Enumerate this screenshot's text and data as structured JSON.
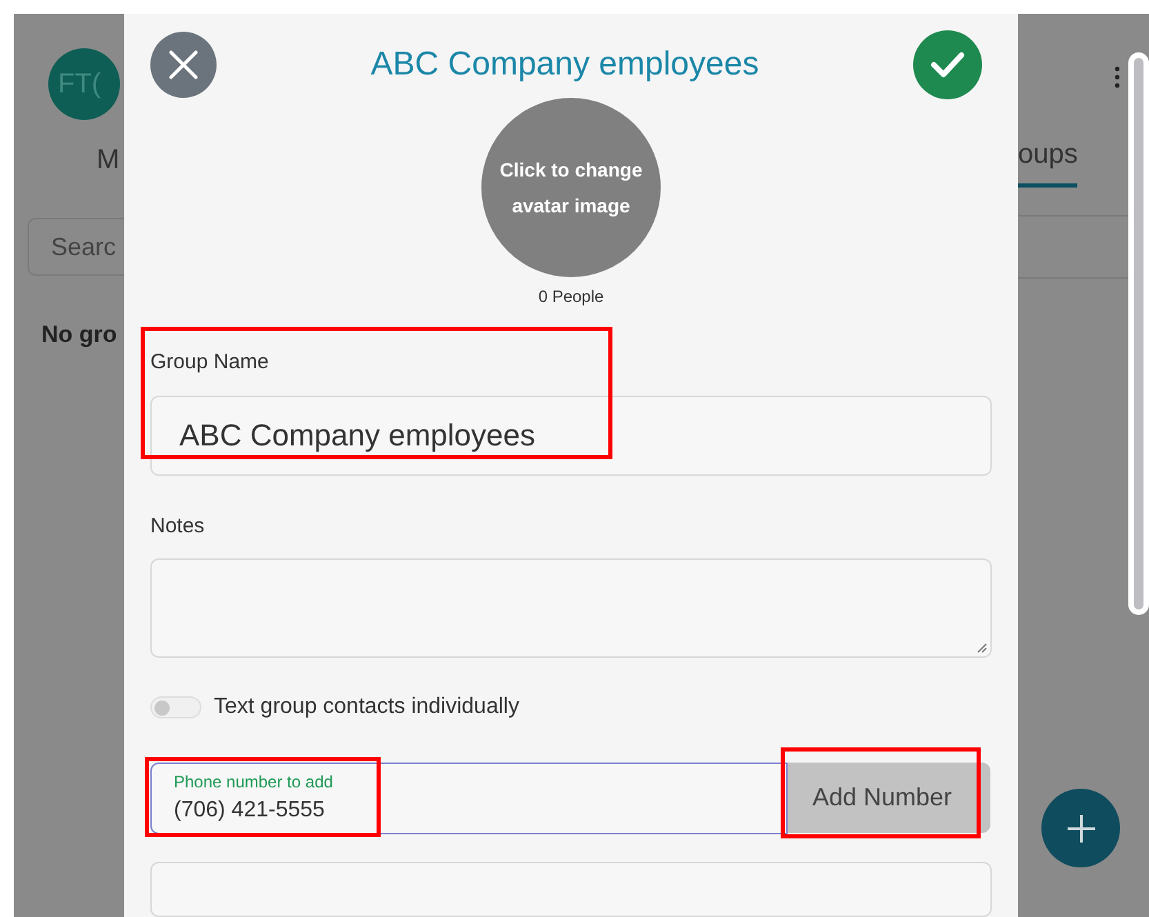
{
  "background": {
    "avatar_initials": "FT(",
    "tabs": [
      {
        "label": "M",
        "selected": false
      },
      {
        "label": "oups",
        "selected": true
      }
    ],
    "search_placeholder": "Searc",
    "empty_text": "No gro"
  },
  "dialog": {
    "title": "ABC Company employees",
    "avatar_text": "Click to change avatar image",
    "people_count": "0 People",
    "group_name": {
      "label": "Group Name",
      "value": "ABC Company employees"
    },
    "notes": {
      "label": "Notes"
    },
    "toggle": {
      "label": "Text group contacts individually",
      "on": false
    },
    "phone": {
      "label": "Phone number to add",
      "value": "(706) 421-5555"
    },
    "add_button": "Add Number"
  }
}
